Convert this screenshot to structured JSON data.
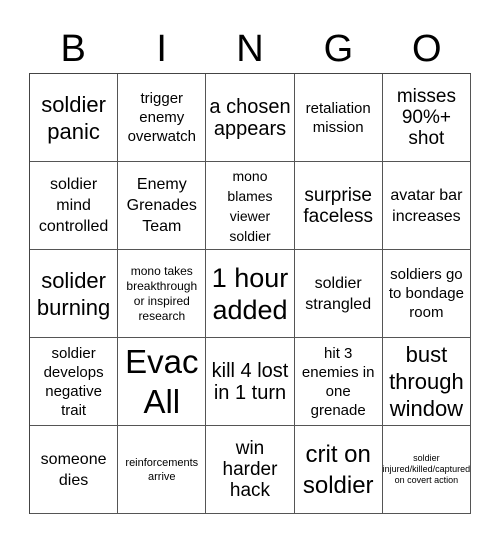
{
  "header": [
    "B",
    "I",
    "N",
    "G",
    "O"
  ],
  "cells": [
    [
      "soldier panic",
      "trigger enemy overwatch",
      "a chosen appears",
      "retaliation mission",
      "misses 90%+ shot"
    ],
    [
      "soldier mind controlled",
      "Enemy Grenades Team",
      "mono blames viewer soldier",
      "surprise faceless",
      "avatar bar increases"
    ],
    [
      "solider burning",
      "mono takes breakthrough or inspired research",
      "1 hour added",
      "soldier strangled",
      "soldiers go to bondage room"
    ],
    [
      "soldier develops negative trait",
      "Evac All",
      "kill 4 lost in 1 turn",
      "hit 3 enemies in one grenade",
      "bust through window"
    ],
    [
      "someone dies",
      "reinforcements arrive",
      "win harder hack",
      "crit on soldier",
      "soldier injured/killed/captured on covert action"
    ]
  ]
}
